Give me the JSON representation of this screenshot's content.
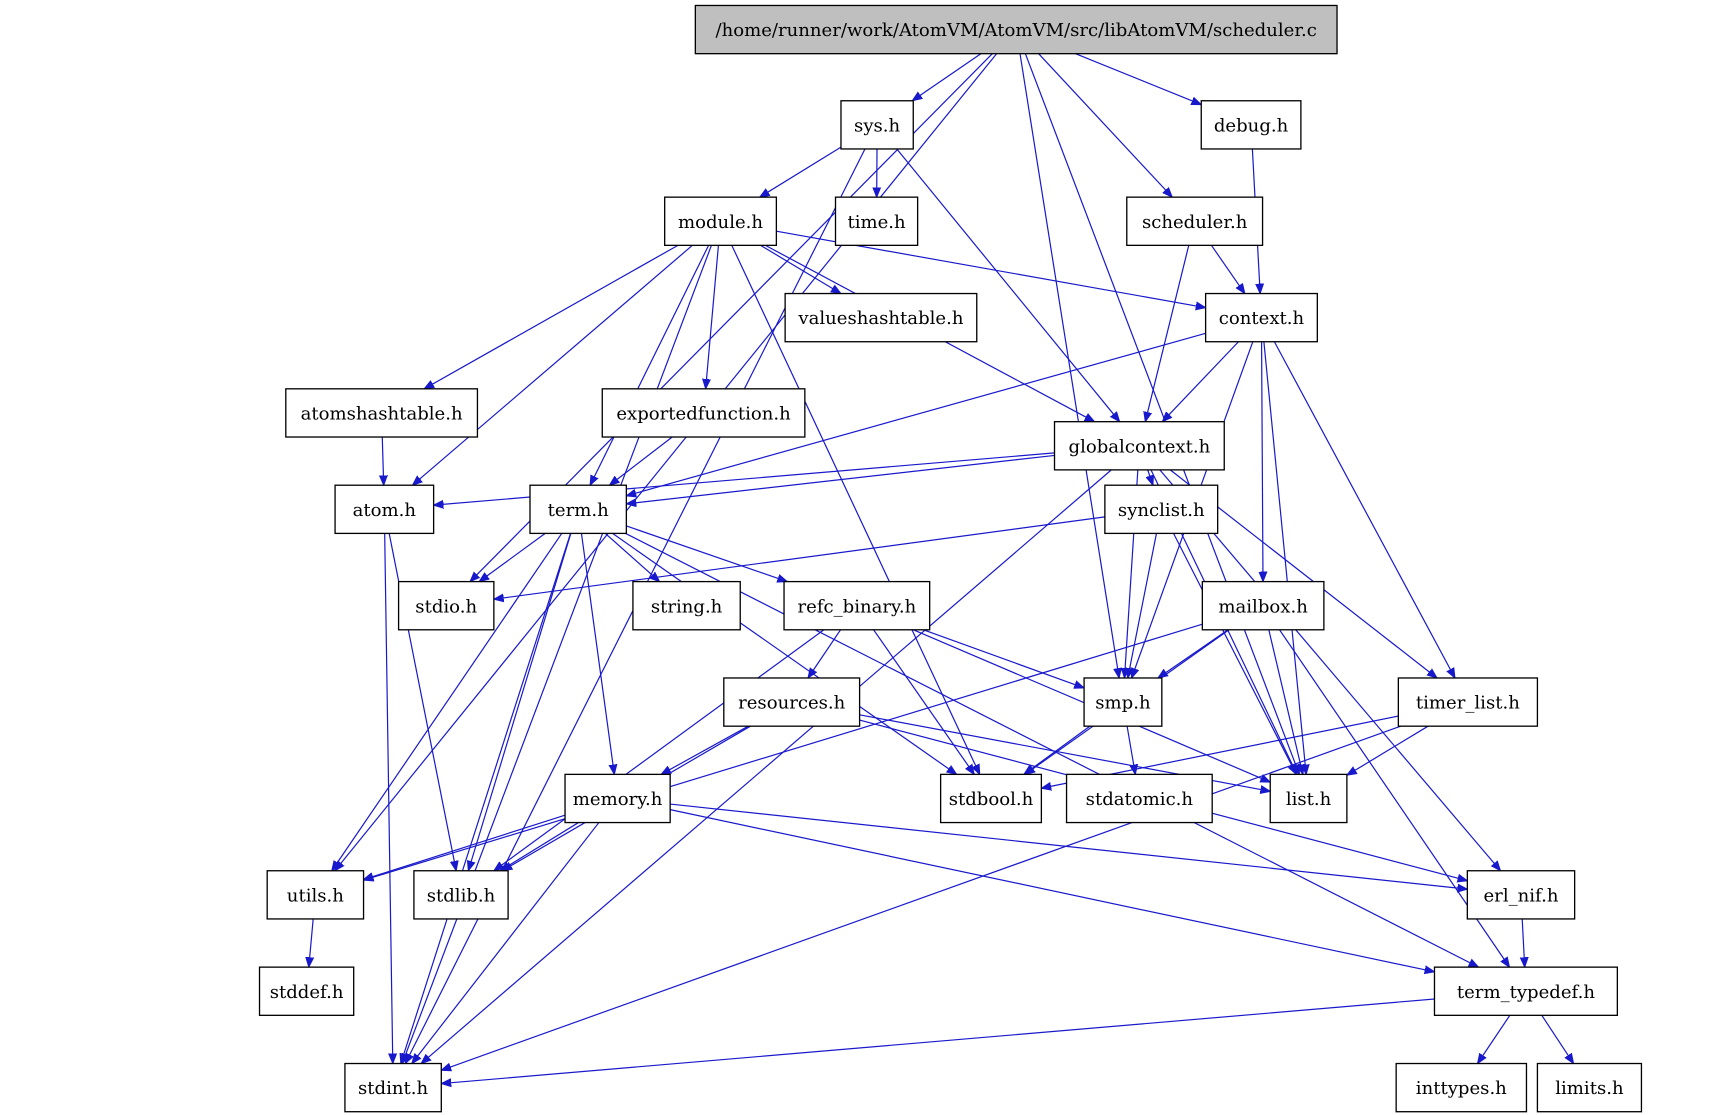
{
  "title": "/home/runner/work/AtomVM/AtomVM/src/libAtomVM/scheduler.c",
  "colors": {
    "edge": "#1919cc",
    "root_fill": "#bfbfbf",
    "node_fill": "#ffffff",
    "border": "#000000"
  },
  "nodes": [
    {
      "id": "root",
      "label": "/home/runner/work/AtomVM/AtomVM/src/libAtomVM/scheduler.c"
    },
    {
      "id": "sys",
      "label": "sys.h"
    },
    {
      "id": "debug",
      "label": "debug.h"
    },
    {
      "id": "module",
      "label": "module.h"
    },
    {
      "id": "time",
      "label": "time.h"
    },
    {
      "id": "scheduler",
      "label": "scheduler.h"
    },
    {
      "id": "context",
      "label": "context.h"
    },
    {
      "id": "valueshashtable",
      "label": "valueshashtable.h"
    },
    {
      "id": "atomshashtable",
      "label": "atomshashtable.h"
    },
    {
      "id": "exportedfunction",
      "label": "exportedfunction.h"
    },
    {
      "id": "globalcontext",
      "label": "globalcontext.h"
    },
    {
      "id": "atom",
      "label": "atom.h"
    },
    {
      "id": "term",
      "label": "term.h"
    },
    {
      "id": "synclist",
      "label": "synclist.h"
    },
    {
      "id": "stdio",
      "label": "stdio.h"
    },
    {
      "id": "string",
      "label": "string.h"
    },
    {
      "id": "refc_binary",
      "label": "refc_binary.h"
    },
    {
      "id": "mailbox",
      "label": "mailbox.h"
    },
    {
      "id": "resources",
      "label": "resources.h"
    },
    {
      "id": "smp",
      "label": "smp.h"
    },
    {
      "id": "timer_list",
      "label": "timer_list.h"
    },
    {
      "id": "memory",
      "label": "memory.h"
    },
    {
      "id": "stdbool",
      "label": "stdbool.h"
    },
    {
      "id": "stdatomic",
      "label": "stdatomic.h"
    },
    {
      "id": "list",
      "label": "list.h"
    },
    {
      "id": "utils",
      "label": "utils.h"
    },
    {
      "id": "stdlib",
      "label": "stdlib.h"
    },
    {
      "id": "erl_nif",
      "label": "erl_nif.h"
    },
    {
      "id": "stddef",
      "label": "stddef.h"
    },
    {
      "id": "term_typedef",
      "label": "term_typedef.h"
    },
    {
      "id": "stdint",
      "label": "stdint.h"
    },
    {
      "id": "inttypes",
      "label": "inttypes.h"
    },
    {
      "id": "limits",
      "label": "limits.h"
    }
  ],
  "edges": [
    [
      "root",
      "sys"
    ],
    [
      "root",
      "debug"
    ],
    [
      "root",
      "scheduler"
    ],
    [
      "root",
      "smp"
    ],
    [
      "root",
      "list"
    ],
    [
      "root",
      "utils"
    ],
    [
      "root",
      "stdio"
    ],
    [
      "sys",
      "module"
    ],
    [
      "sys",
      "time"
    ],
    [
      "sys",
      "globalcontext"
    ],
    [
      "sys",
      "stdint"
    ],
    [
      "debug",
      "context"
    ],
    [
      "scheduler",
      "context"
    ],
    [
      "scheduler",
      "globalcontext"
    ],
    [
      "module",
      "valueshashtable"
    ],
    [
      "module",
      "atomshashtable"
    ],
    [
      "module",
      "exportedfunction"
    ],
    [
      "module",
      "atom"
    ],
    [
      "module",
      "term"
    ],
    [
      "module",
      "context"
    ],
    [
      "module",
      "globalcontext"
    ],
    [
      "module",
      "stdbool"
    ],
    [
      "module",
      "stdint"
    ],
    [
      "context",
      "globalcontext"
    ],
    [
      "context",
      "term"
    ],
    [
      "context",
      "mailbox"
    ],
    [
      "context",
      "smp"
    ],
    [
      "context",
      "timer_list"
    ],
    [
      "context",
      "list"
    ],
    [
      "atomshashtable",
      "atom"
    ],
    [
      "exportedfunction",
      "term"
    ],
    [
      "globalcontext",
      "atom"
    ],
    [
      "globalcontext",
      "term"
    ],
    [
      "globalcontext",
      "synclist"
    ],
    [
      "globalcontext",
      "smp"
    ],
    [
      "globalcontext",
      "timer_list"
    ],
    [
      "globalcontext",
      "list"
    ],
    [
      "globalcontext",
      "erl_nif"
    ],
    [
      "globalcontext",
      "stdint"
    ],
    [
      "atom",
      "stdint"
    ],
    [
      "atom",
      "stdlib"
    ],
    [
      "term",
      "stdio"
    ],
    [
      "term",
      "string"
    ],
    [
      "term",
      "refc_binary"
    ],
    [
      "term",
      "memory"
    ],
    [
      "term",
      "utils"
    ],
    [
      "term",
      "stdlib"
    ],
    [
      "term",
      "stdbool"
    ],
    [
      "term",
      "stdint"
    ],
    [
      "term",
      "term_typedef"
    ],
    [
      "synclist",
      "stdio"
    ],
    [
      "synclist",
      "smp"
    ],
    [
      "synclist",
      "list"
    ],
    [
      "refc_binary",
      "resources"
    ],
    [
      "refc_binary",
      "smp"
    ],
    [
      "refc_binary",
      "stdbool"
    ],
    [
      "refc_binary",
      "list"
    ],
    [
      "refc_binary",
      "stdlib"
    ],
    [
      "mailbox",
      "smp"
    ],
    [
      "mailbox",
      "list"
    ],
    [
      "mailbox",
      "stdbool"
    ],
    [
      "mailbox",
      "utils"
    ],
    [
      "mailbox",
      "term_typedef"
    ],
    [
      "resources",
      "memory"
    ],
    [
      "resources",
      "list"
    ],
    [
      "resources",
      "stdlib"
    ],
    [
      "resources",
      "erl_nif"
    ],
    [
      "smp",
      "stdbool"
    ],
    [
      "smp",
      "stdatomic"
    ],
    [
      "timer_list",
      "list"
    ],
    [
      "timer_list",
      "stdbool"
    ],
    [
      "timer_list",
      "stdint"
    ],
    [
      "memory",
      "utils"
    ],
    [
      "memory",
      "stdlib"
    ],
    [
      "memory",
      "stdint"
    ],
    [
      "memory",
      "erl_nif"
    ],
    [
      "memory",
      "term_typedef"
    ],
    [
      "utils",
      "stddef"
    ],
    [
      "erl_nif",
      "term_typedef"
    ],
    [
      "term_typedef",
      "inttypes"
    ],
    [
      "term_typedef",
      "limits"
    ],
    [
      "term_typedef",
      "stdint"
    ]
  ]
}
